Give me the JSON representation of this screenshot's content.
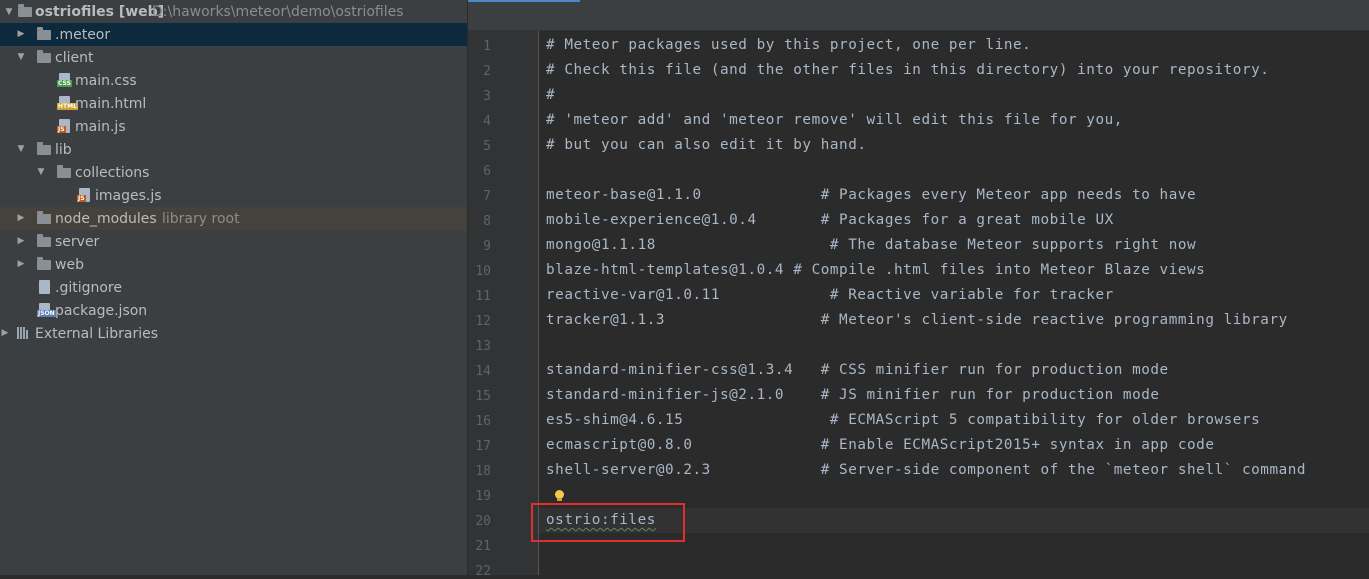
{
  "project_tree": {
    "root": {
      "name": "ostriofiles",
      "module_tag": "[web]",
      "path": "D:\\haworks\\meteor\\demo\\ostriofiles"
    },
    "items": [
      {
        "label": "ostriofiles [web]",
        "hint": "D:\\haworks\\meteor\\demo\\ostriofiles"
      },
      {
        "label": ".meteor"
      },
      {
        "label": "client"
      },
      {
        "label": "main.css",
        "icon_tag": "CSS"
      },
      {
        "label": "main.html",
        "icon_tag": "HTML"
      },
      {
        "label": "main.js",
        "icon_tag": "JS"
      },
      {
        "label": "lib"
      },
      {
        "label": "collections"
      },
      {
        "label": "images.js",
        "icon_tag": "JS"
      },
      {
        "label": "node_modules",
        "hint": "library root"
      },
      {
        "label": "server"
      },
      {
        "label": "web"
      },
      {
        "label": ".gitignore"
      },
      {
        "label": "package.json",
        "icon_tag": "JSON"
      },
      {
        "label": "External Libraries"
      }
    ]
  },
  "editor": {
    "line_numbers": [
      "1",
      "2",
      "3",
      "4",
      "5",
      "6",
      "7",
      "8",
      "9",
      "10",
      "11",
      "12",
      "13",
      "14",
      "15",
      "16",
      "17",
      "18",
      "19",
      "20",
      "21",
      "22"
    ],
    "lines": [
      "# Meteor packages used by this project, one per line.",
      "# Check this file (and the other files in this directory) into your repository.",
      "#",
      "# 'meteor add' and 'meteor remove' will edit this file for you,",
      "# but you can also edit it by hand.",
      "",
      "meteor-base@1.1.0             # Packages every Meteor app needs to have",
      "mobile-experience@1.0.4       # Packages for a great mobile UX",
      "mongo@1.1.18                   # The database Meteor supports right now",
      "blaze-html-templates@1.0.4 # Compile .html files into Meteor Blaze views",
      "reactive-var@1.0.11            # Reactive variable for tracker",
      "tracker@1.1.3                 # Meteor's client-side reactive programming library",
      "",
      "standard-minifier-css@1.3.4   # CSS minifier run for production mode",
      "standard-minifier-js@2.1.0    # JS minifier run for production mode",
      "es5-shim@4.6.15                # ECMAScript 5 compatibility for older browsers",
      "ecmascript@0.8.0              # Enable ECMAScript2015+ syntax in app code",
      "shell-server@0.2.3            # Server-side component of the `meteor shell` command",
      "",
      "ostrio:files",
      "",
      ""
    ]
  },
  "colors": {
    "panel_bg": "#3c3f41",
    "editor_bg": "#2b2b2b",
    "selection": "#0d293e",
    "highlight_box": "#e0302e"
  }
}
